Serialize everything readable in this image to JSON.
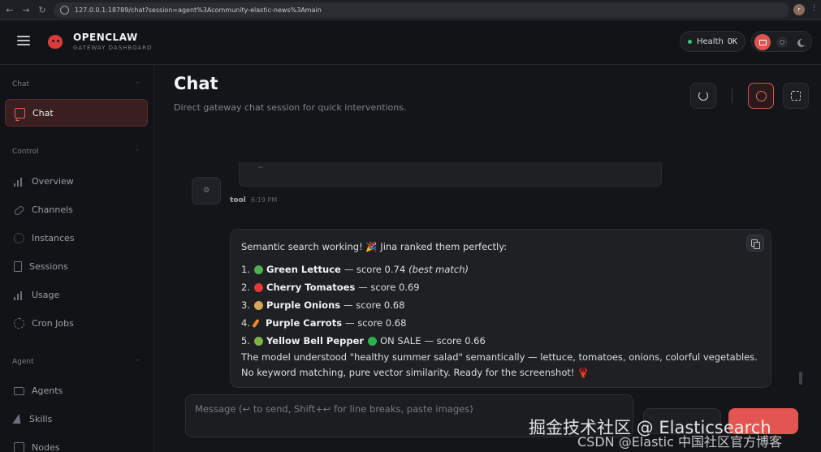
{
  "browser": {
    "url": "127.0.0.1:18789/chat?session=agent%3Acommunity-elastic-news%3Amain",
    "profile_initial": "r"
  },
  "header": {
    "brand_title": "OPENCLAW",
    "brand_subtitle": "GATEWAY DASHBOARD",
    "health_label": "Health",
    "health_value": "OK"
  },
  "sidebar": {
    "sections": [
      {
        "label": "Chat",
        "items": [
          {
            "label": "Chat",
            "icon": "chat-bubble-icon",
            "active": true
          }
        ]
      },
      {
        "label": "Control",
        "items": [
          {
            "label": "Overview",
            "icon": "bar-chart-icon"
          },
          {
            "label": "Channels",
            "icon": "link-icon"
          },
          {
            "label": "Instances",
            "icon": "radio-icon"
          },
          {
            "label": "Sessions",
            "icon": "document-icon"
          },
          {
            "label": "Usage",
            "icon": "bar-chart-icon"
          },
          {
            "label": "Cron Jobs",
            "icon": "loader-icon"
          }
        ]
      },
      {
        "label": "Agent",
        "items": [
          {
            "label": "Agents",
            "icon": "folder-icon"
          },
          {
            "label": "Skills",
            "icon": "zap-icon"
          },
          {
            "label": "Nodes",
            "icon": "nodes-icon"
          }
        ]
      }
    ]
  },
  "page": {
    "title": "Chat",
    "subtitle": "Direct gateway chat session for quick interventions."
  },
  "thread": {
    "code_tail": "~",
    "tool_sender": "tool",
    "tool_time": "6:19 PM",
    "assistant": {
      "intro": "Semantic search working! 🎉 Jina ranked them perfectly:",
      "results": [
        {
          "num": "1.",
          "name": "Green Lettuce",
          "score": "— score 0.74",
          "note": "(best match)",
          "color": "#4caf50"
        },
        {
          "num": "2.",
          "name": "Cherry Tomatoes",
          "score": "— score 0.69",
          "note": "",
          "color": "#e53935"
        },
        {
          "num": "3.",
          "name": "Purple Onions",
          "score": "— score 0.68",
          "note": "",
          "color": "#d4a55a"
        },
        {
          "num": "4.",
          "name": "Purple Carrots",
          "score": "— score 0.68",
          "note": "",
          "color": "#f08a2b"
        },
        {
          "num": "5.",
          "name": "Yellow Bell Pepper",
          "score": "— score 0.66",
          "note": "",
          "color": "#7cb342",
          "badge": "ON SALE"
        }
      ],
      "summary": "The model understood \"healthy summer salad\" semantically — lettuce, tomatoes, onions, colorful vegetables. No keyword matching, pure vector similarity. Ready for the screenshot! 🦞"
    }
  },
  "composer": {
    "placeholder": "Message (↩ to send, Shift+↩ for line breaks, paste images)"
  },
  "watermark": {
    "line1": "掘金技术社区 @ Elasticsearch",
    "line2": "CSDN @Elastic 中国社区官方博客"
  },
  "colors": {
    "accent": "#e25550",
    "ok": "#2ecc71",
    "active_bg": "#3a1f21"
  }
}
